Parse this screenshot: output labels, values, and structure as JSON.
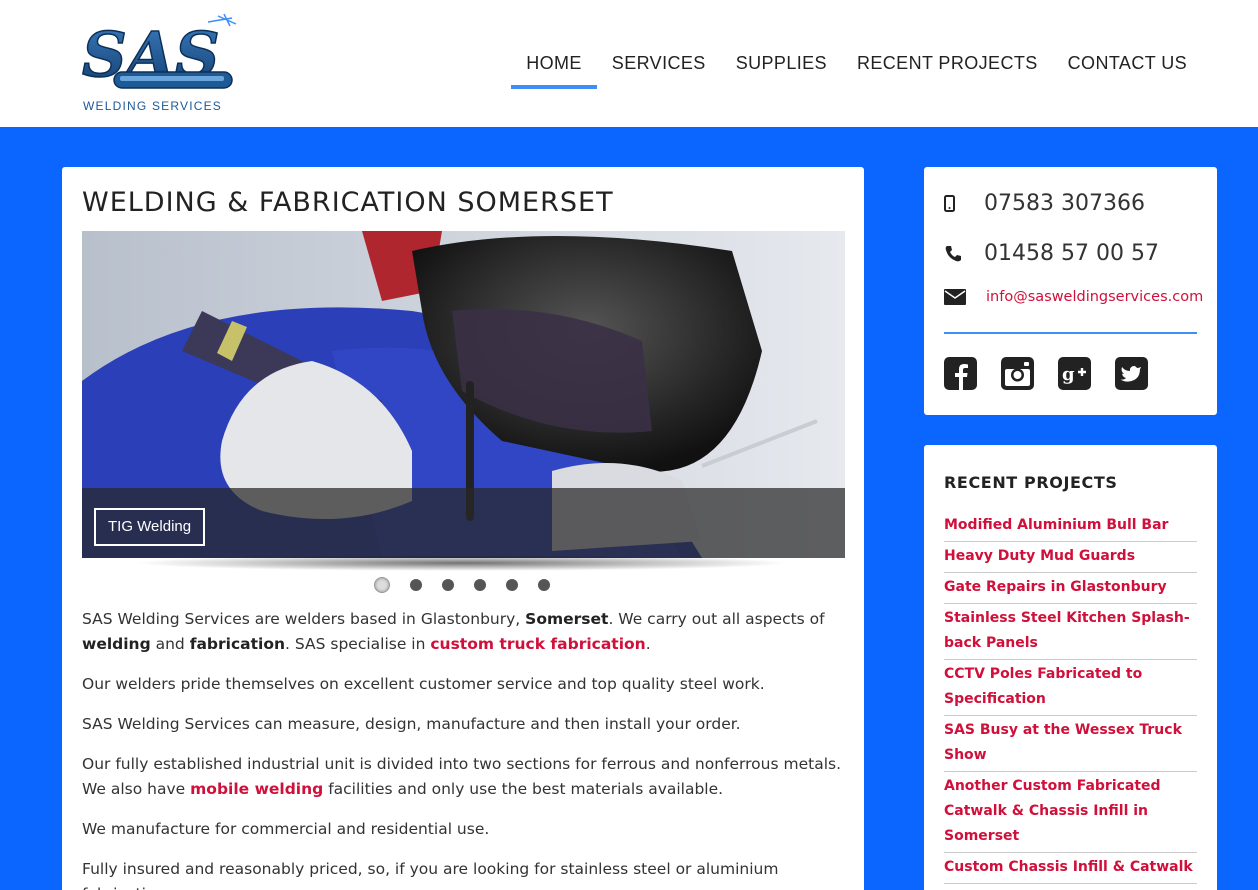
{
  "brand": {
    "logo_text": "SAS",
    "logo_subtext": "WELDING SERVICES"
  },
  "nav": {
    "items": [
      {
        "label": "HOME"
      },
      {
        "label": "SERVICES"
      },
      {
        "label": "SUPPLIES"
      },
      {
        "label": "RECENT PROJECTS"
      },
      {
        "label": "CONTACT US"
      }
    ],
    "active": "HOME"
  },
  "main": {
    "title": "WELDING & FABRICATION SOMERSET",
    "slider": {
      "caption": "TIG Welding",
      "slide_count": 6,
      "active_index": 0
    },
    "paragraphs": {
      "p1": {
        "t1": "SAS Welding Services are welders based in Glastonbury, ",
        "b1": "Somerset",
        "t2": ". We carry out all aspects of ",
        "b2": "welding",
        "t3": " and ",
        "b3": "fabrication",
        "t4": ". SAS specialise in ",
        "link": "custom truck fabrication",
        "t5": "."
      },
      "p2": "Our welders pride themselves on excellent customer service and top quality steel work.",
      "p3": "SAS Welding Services can measure, design, manufacture and then install your order.",
      "p4": {
        "t1": "Our fully established industrial unit is divided into two sections for ferrous and nonferrous metals. We also have ",
        "link": "mobile welding",
        "t2": " facilities and only use the best materials available."
      },
      "p5": "We manufacture for commercial and residential use.",
      "p6": "Fully insured and reasonably priced, so, if you are looking for stainless steel or aluminium fabrication"
    }
  },
  "contact": {
    "mobile": "07583 307366",
    "landline": "01458 57 00 57",
    "email": "info@sasweldingservices.com",
    "social_icons": [
      "facebook-icon",
      "instagram-icon",
      "google-plus-icon",
      "twitter-icon"
    ]
  },
  "projects": {
    "title": "RECENT PROJECTS",
    "items": [
      "Modified Aluminium Bull Bar",
      "Heavy Duty Mud Guards",
      "Gate Repairs in Glastonbury",
      "Stainless Steel Kitchen Splash-back Panels",
      "CCTV Poles Fabricated to Specification",
      "SAS Busy at the Wessex Truck Show",
      "Another Custom Fabricated Catwalk & Chassis Infill in Somerset",
      "Custom Chassis Infill & Catwalk"
    ]
  },
  "colors": {
    "background": "#0a66ff",
    "accent": "#3d8ef8",
    "link": "#d0103a",
    "logo": "#1e5a96"
  }
}
